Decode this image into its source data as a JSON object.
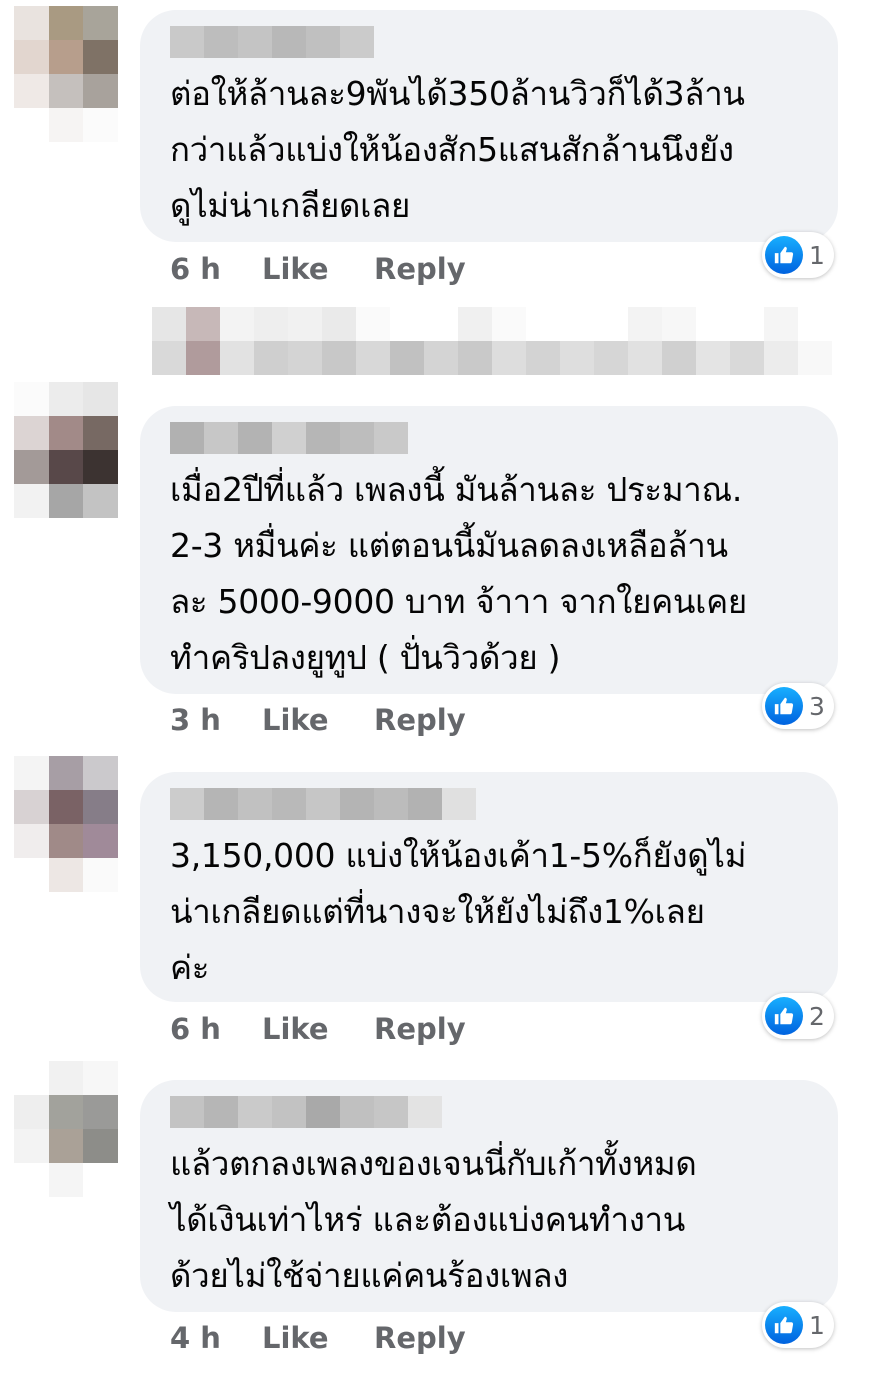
{
  "comments": [
    {
      "text": "ต่อให้ล้านละ9พันได้350ล้านวิวก็ได้3ล้าน\nกว่าแล้วแบ่งให้น้องสัก5แสนสักล้านนึงยัง\nดูไม่น่าเกลียดเลย",
      "time": "6 h",
      "like_label": "Like",
      "reply_label": "Reply",
      "reactions": "1"
    },
    {
      "text": "เมื่อ2ปีที่แล้ว เพลงนี้ มันล้านละ ประมาณ.\n2-3 หมื่นค่ะ แต่ตอนนี้มันลดลงเหลือล้าน\nละ 5000-9000 บาท จ้าาา จากใยคนเคย\nทำคริปลงยูทูป ( ปั่นวิวด้วย )",
      "time": "3 h",
      "like_label": "Like",
      "reply_label": "Reply",
      "reactions": "3"
    },
    {
      "text": "3,150,000 แบ่งให้น้องเค้า1-5%ก็ยังดูไม่\nน่าเกลียดแต่ที่นางจะให้ยังไม่ถึง1%เลย\nค่ะ",
      "time": "6 h",
      "like_label": "Like",
      "reply_label": "Reply",
      "reactions": "2"
    },
    {
      "text": "แล้วตกลงเพลงของเจนนี่กับเก้าทั้งหมด\nได้เงินเท่าไหร่ และต้องแบ่งคนทำงาน\nด้วยไม่ใช้จ่ายแค่คนร้องเพลง",
      "time": "4 h",
      "like_label": "Like",
      "reply_label": "Reply",
      "reactions": "1"
    }
  ],
  "icons": {
    "reaction": "like-thumb-icon",
    "avatar": "pixelated-avatar"
  },
  "colors": {
    "bubble": "#f0f2f5",
    "meta_text": "#65676b",
    "like_blue": "#1877f2"
  }
}
